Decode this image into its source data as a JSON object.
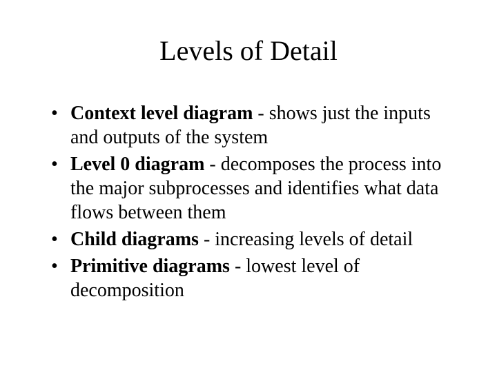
{
  "title": "Levels of Detail",
  "bullets": [
    {
      "bold": "Context level diagram",
      "rest": " - shows just the inputs and outputs of the system"
    },
    {
      "bold": "Level 0 diagram",
      "rest": " - decomposes the process into the major subprocesses and identifies what data flows between them"
    },
    {
      "bold": "Child diagrams",
      "rest": " - increasing levels of detail"
    },
    {
      "bold": "Primitive diagrams",
      "rest": " - lowest level of decomposition"
    }
  ]
}
